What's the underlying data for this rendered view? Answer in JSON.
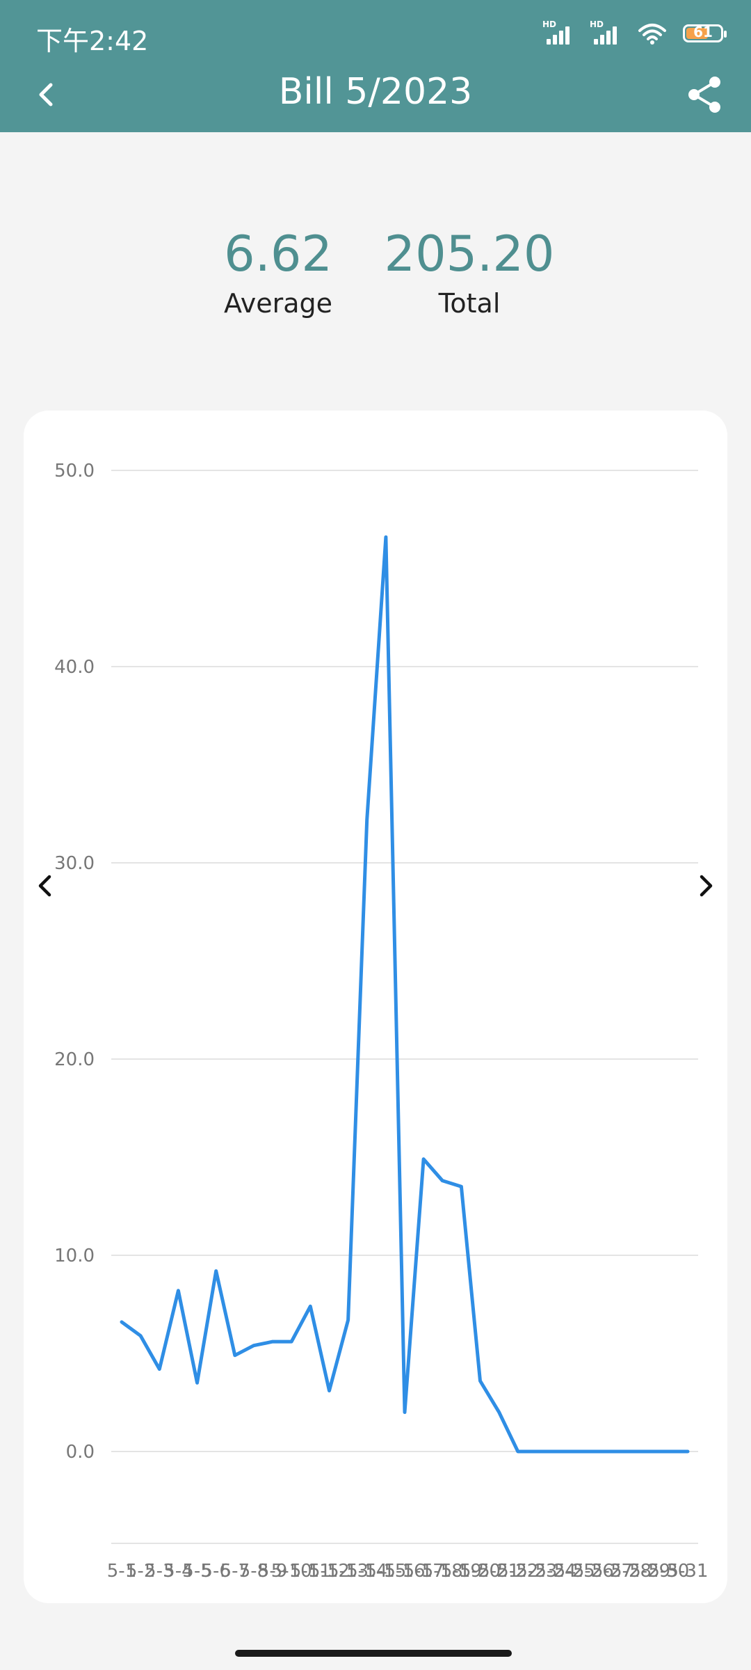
{
  "status_bar": {
    "time": "下午2:42",
    "battery_level": "61",
    "icons": [
      "hd-signal-icon",
      "hd-signal-icon",
      "wifi-icon",
      "battery-icon"
    ]
  },
  "header": {
    "title": "Bill 5/2023",
    "back_icon": "chevron-left-icon",
    "share_icon": "share-icon",
    "background_color": "#529596"
  },
  "stats": {
    "average_value": "6.62",
    "average_label": "Average",
    "total_value": "205.20",
    "total_label": "Total",
    "accent_color": "#4f8f90"
  },
  "chart_data": {
    "type": "line",
    "title": "",
    "xlabel": "",
    "ylabel": "",
    "ylim": [
      -4.67,
      50
    ],
    "y_ticks": [
      "0.0",
      "10.0",
      "20.0",
      "30.0",
      "40.0",
      "50.0"
    ],
    "grid": true,
    "line_color": "#2f8ee5",
    "categories": [
      "5-1",
      "5-2",
      "5-3",
      "5-4",
      "5-5",
      "5-6",
      "5-7",
      "5-8",
      "5-9",
      "5-10",
      "5-11",
      "5-12",
      "5-13",
      "5-14",
      "5-15",
      "5-16",
      "5-17",
      "5-18",
      "5-19",
      "5-20",
      "5-21",
      "5-22",
      "5-23",
      "5-24",
      "5-25",
      "5-26",
      "5-27",
      "5-28",
      "5-29",
      "5-30",
      "5-31"
    ],
    "values": [
      6.6,
      5.9,
      4.2,
      8.2,
      3.5,
      9.2,
      4.9,
      5.4,
      5.6,
      5.6,
      7.4,
      3.1,
      6.7,
      32.2,
      46.6,
      2.0,
      14.9,
      13.8,
      13.5,
      3.6,
      2.0,
      0.0,
      0.0,
      0.0,
      0.0,
      0.0,
      0.0,
      0.0,
      0.0,
      0.0,
      0.0
    ]
  },
  "navigation": {
    "prev_icon": "chevron-left-icon",
    "next_icon": "chevron-right-icon"
  }
}
